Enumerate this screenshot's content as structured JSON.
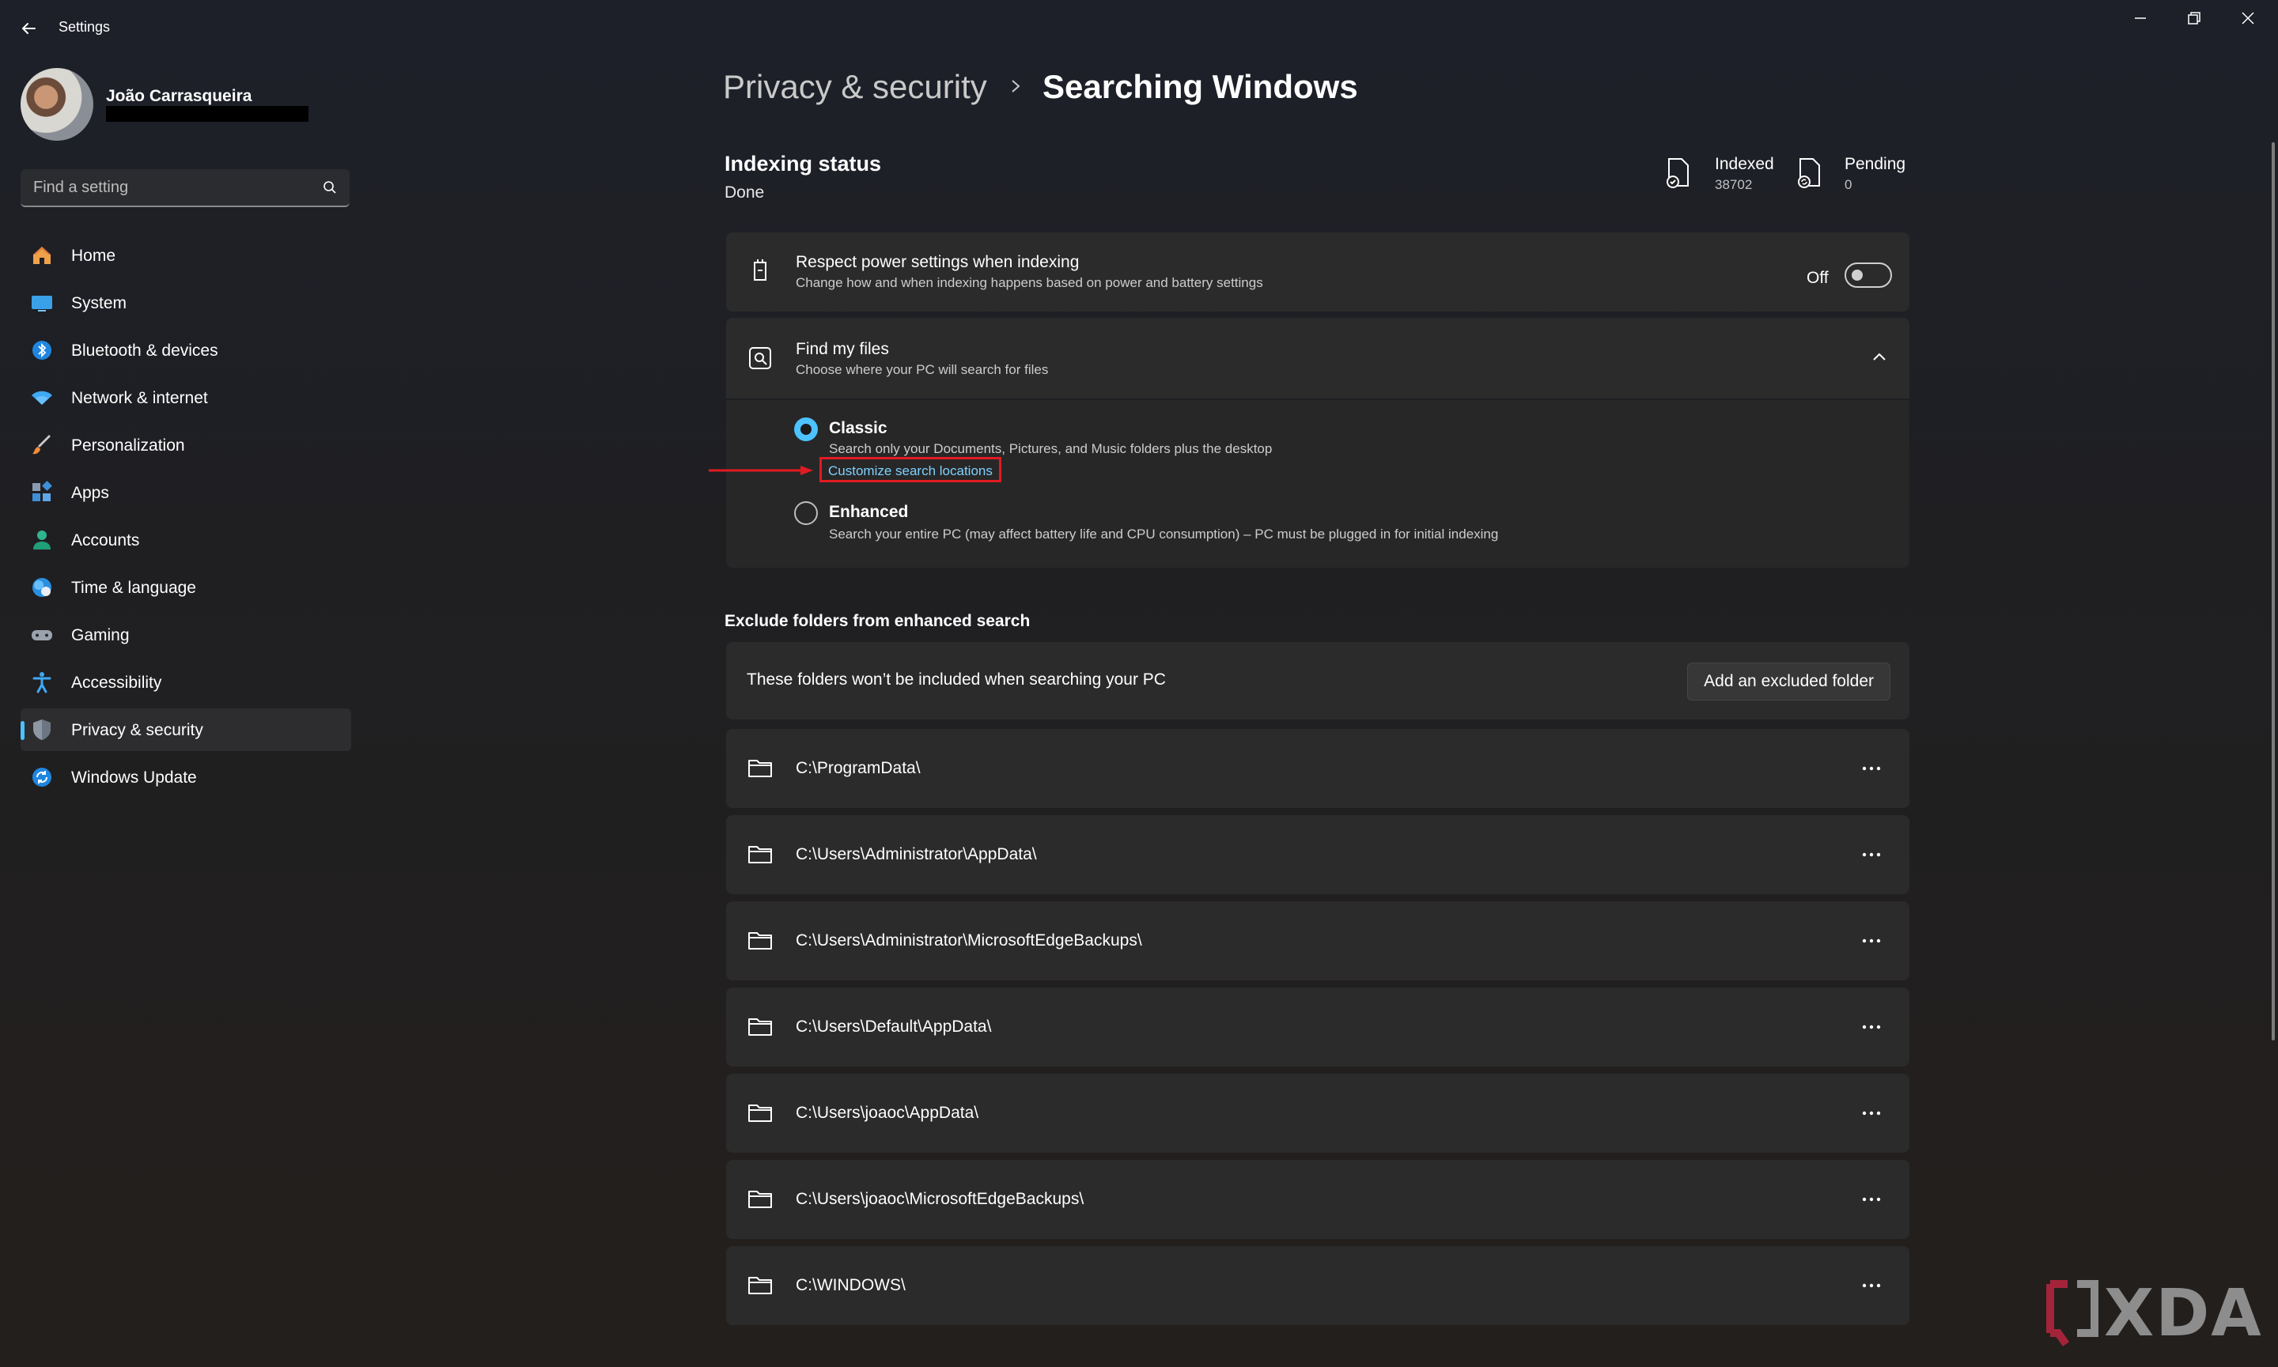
{
  "app": {
    "title": "Settings"
  },
  "profile": {
    "name": "João Carrasqueira"
  },
  "search": {
    "placeholder": "Find a setting"
  },
  "nav": {
    "items": [
      {
        "label": "Home",
        "icon": "home-icon"
      },
      {
        "label": "System",
        "icon": "system-icon"
      },
      {
        "label": "Bluetooth & devices",
        "icon": "bluetooth-icon"
      },
      {
        "label": "Network & internet",
        "icon": "wifi-icon"
      },
      {
        "label": "Personalization",
        "icon": "brush-icon"
      },
      {
        "label": "Apps",
        "icon": "apps-icon"
      },
      {
        "label": "Accounts",
        "icon": "accounts-icon"
      },
      {
        "label": "Time & language",
        "icon": "globe-icon"
      },
      {
        "label": "Gaming",
        "icon": "gamepad-icon"
      },
      {
        "label": "Accessibility",
        "icon": "accessibility-icon"
      },
      {
        "label": "Privacy & security",
        "icon": "shield-icon",
        "selected": true
      },
      {
        "label": "Windows Update",
        "icon": "update-icon"
      }
    ]
  },
  "breadcrumb": {
    "parent": "Privacy & security",
    "current": "Searching Windows"
  },
  "indexing": {
    "title": "Indexing status",
    "status": "Done",
    "indexed_label": "Indexed",
    "indexed_value": "38702",
    "pending_label": "Pending",
    "pending_value": "0"
  },
  "power": {
    "title": "Respect power settings when indexing",
    "description": "Change how and when indexing happens based on power and battery settings",
    "toggle_label": "Off",
    "toggle_on": false
  },
  "find_files": {
    "title": "Find my files",
    "description": "Choose where your PC will search for files",
    "expanded": true,
    "options": {
      "classic": {
        "title": "Classic",
        "description": "Search only your Documents, Pictures, and Music folders plus the desktop",
        "link": "Customize search locations",
        "selected": true
      },
      "enhanced": {
        "title": "Enhanced",
        "description": "Search your entire PC (may affect battery life and CPU consumption) – PC must be plugged in for initial indexing",
        "selected": false
      }
    }
  },
  "exclude": {
    "title": "Exclude folders from enhanced search",
    "description": "These folders won’t be included when searching your PC",
    "add_button": "Add an excluded folder",
    "folders": [
      "C:\\ProgramData\\",
      "C:\\Users\\Administrator\\AppData\\",
      "C:\\Users\\Administrator\\MicrosoftEdgeBackups\\",
      "C:\\Users\\Default\\AppData\\",
      "C:\\Users\\joaoc\\AppData\\",
      "C:\\Users\\joaoc\\MicrosoftEdgeBackups\\",
      "C:\\WINDOWS\\"
    ]
  },
  "watermark": {
    "text": "XDA"
  },
  "colors": {
    "accent": "#4cc2ff",
    "highlight": "#e21a22",
    "card": "#2b2b2b"
  }
}
